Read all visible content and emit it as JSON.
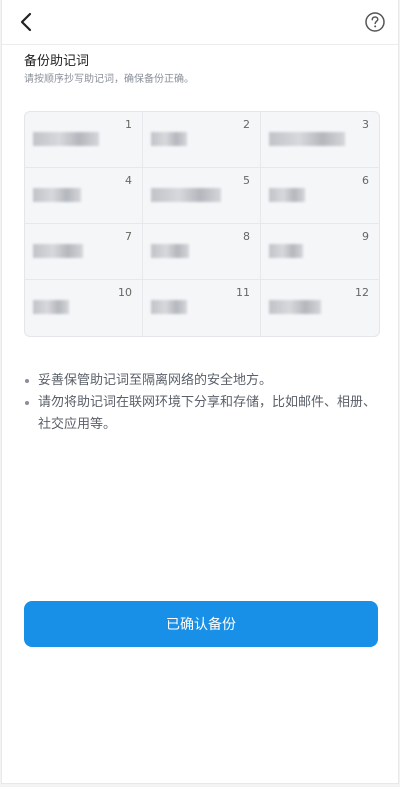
{
  "header": {
    "back_icon": "chevron-left-icon",
    "help_icon": "question-circle-icon"
  },
  "section": {
    "title": "备份助记词",
    "subtitle": "请按顺序抄写助记词，确保备份正确。"
  },
  "mnemonic": {
    "numbers": [
      "1",
      "2",
      "3",
      "4",
      "5",
      "6",
      "7",
      "8",
      "9",
      "10",
      "11",
      "12"
    ]
  },
  "tips": [
    "妥善保管助记词至隔离网络的安全地方。",
    "请勿将助记词在联网环境下分享和存储，比如邮件、相册、社交应用等。"
  ],
  "actions": {
    "confirm_label": "已确认备份"
  },
  "colors": {
    "primary": "#1890e8",
    "grid_bg": "#f5f6f8"
  }
}
